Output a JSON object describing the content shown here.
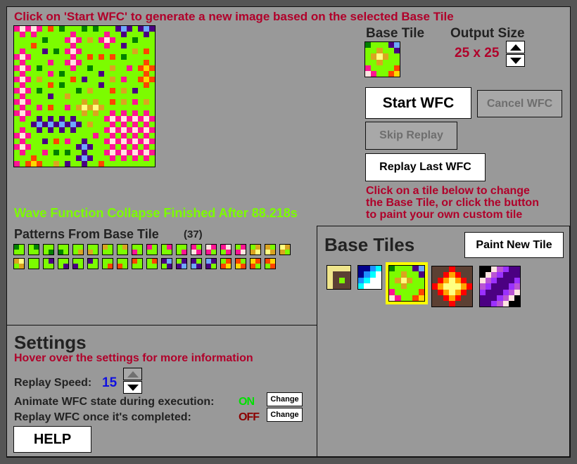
{
  "header": {
    "instruction": "Click on 'Start WFC' to generate a new image based on the selected Base Tile"
  },
  "palette": {
    "G": "#7CFC00",
    "P": "#FF1493",
    "W": "#FFE4E1",
    "O": "#FF4500",
    "D": "#008000",
    "U": "#4B0082",
    "B": "#6EA8FF",
    "A": "#DAA520",
    "Y": "#FFD700",
    "L": "#FFFF80",
    "K": "#000000",
    "N": "#00008B",
    "Z": "#1E90FF",
    "C": "#00FFFF",
    "X": "#FFFFFF",
    "E": "#F0E68C",
    "R": "#FF0000",
    "F": "#FFA500",
    "H": "#5C4033",
    "M": "#BA55D3",
    "V": "#9B30FF",
    "Q": "#FFFF80"
  },
  "output": {
    "size": 25,
    "rows": [
      "PWPWPGOGDGGGDGDGGGUBUGUBU",
      "GPGPGGGGGGPGGGGGPGGUGGGUG",
      "GGGGGDGGGPWPGAGPWPGGGDGGG",
      "GGGOGGGGGGPGGGGGPGGUGGGGG",
      "GPGGGUGDGPWPGGGGGGGGGAGOG",
      "PWPGGGGGGGPGGOGOGOGDGGGGG",
      "GPGGGGPGGPWPGGGGGGGGGGGOG",
      "PWPGDGGGGGPGGDGGGAGGPGOYO",
      "GPGGGGPGDGGGGGGUGGGGGGGOG",
      "PWPGAGGGGGOGUGGGGAGPGGOYO",
      "GPGGGGOGDGGGGGGUGGGGGGGOG",
      "PWPGDGGGGGGDGAGGGOGAGUGGG",
      "GPGGGGUGGAGGGGGGGGGGGGGGG",
      "PWPGGGGGGGGGAGAGGOGAGPGAG",
      "GPGGPGOGGPGALALAGGGGGGGGG",
      "PWPGGGGGGGGGAGAGGPGPGPGPG",
      "GPGGUGUGUGUGGGGGPWPWPWPWP",
      "GGGUBUBUBUBUGAGGGPGPGPGPG",
      "GPGGUGUGUGUGGGGGPWPWPWPWP",
      "PWPGGGGGGGGGGGPGGPGPGPGPG",
      "GPGGGUGOGPGGUGGGPWPWPWPWP",
      "PWPGGGGGGGGUBUGGGPGPGPGPG",
      "GPGGGPGDGDGGUGGGPWPWPWPWP",
      "GGGOGGGGGGGUBUGGGPGPGPGPG",
      "PGOYOGGAGUGGUGGOGGGGGGGGG"
    ]
  },
  "side": {
    "base_tile_label": "Base Tile",
    "output_size_label": "Output Size",
    "output_size_value": "25 x 25",
    "base_tile_rows": [
      "DGGGUB",
      "GGAGGU",
      "GALAGG",
      "GGAGGG",
      "PGGGGO",
      "WPGGOY"
    ],
    "start_label": "Start WFC",
    "cancel_label": "Cancel WFC",
    "skip_label": "Skip Replay",
    "replay_label": "Replay Last WFC",
    "hint": [
      "Click on a tile below to change",
      "the Base Tile, or click the button",
      "to paint your own custom tile"
    ]
  },
  "status": {
    "text": "Wave Function Collapse Finished After 88.218s",
    "color": "#7CFC00"
  },
  "patterns": {
    "title": "Patterns From Base Tile",
    "count": "(37)",
    "items": [
      "DGGG",
      "GDGG",
      "GGGD",
      "GGDG",
      "GGGA",
      "GGAG",
      "AGGG",
      "GAGG",
      "GGPG",
      "PGGG",
      "GPGG",
      "GGGP",
      "PGWP",
      "WPPG",
      "PWGP",
      "GPPW",
      "GAAL",
      "AGLA",
      "LAAG",
      "ALGA",
      "GGGG",
      "GUGG",
      "GGGU",
      "GGUG",
      "UGGG",
      "GGGO",
      "GGOG",
      "OGGG",
      "GOGG",
      "UBGU",
      "GUUB",
      "UGBU",
      "BUUG",
      "GOOY",
      "OGYO",
      "YOOG",
      "OYGO"
    ]
  },
  "base_tiles": {
    "title": "Base Tiles",
    "paint_label": "Paint New Tile",
    "selected_index": 2,
    "tiles": [
      {
        "name": "brown-square-tile",
        "rows": [
          "EEEE",
          "EHHH",
          "EHGH",
          "EHHH"
        ]
      },
      {
        "name": "blue-gradient-tile",
        "rows": [
          "NNZC",
          "NZCX",
          "ZCXX",
          "CXXX"
        ]
      },
      {
        "name": "green-flower-tile",
        "rows": [
          "DGGGUB",
          "GGAGGU",
          "GALAGG",
          "GGAGGG",
          "PGGGGO",
          "WPGGOY"
        ]
      },
      {
        "name": "fire-diamond-tile",
        "rows": [
          "HHHRHHH",
          "HHRFRHH",
          "HRFQFRH",
          "RFQQQFR",
          "HRFQFRH",
          "HHRFRHH",
          "HHHRHHH"
        ]
      },
      {
        "name": "purple-stripe-tile",
        "rows": [
          "KKWMVUU",
          "KWMVUUU",
          "WMVUUUV",
          "MVUUUVM",
          "VUUUVMW",
          "UUUVMWK",
          "UUVMWKK"
        ]
      }
    ]
  },
  "settings": {
    "title": "Settings",
    "hint": "Hover over the settings for more information",
    "replay_speed_label": "Replay Speed:",
    "replay_speed_value": "15",
    "animate_label": "Animate WFC state during execution:",
    "animate_value": "ON",
    "animate_color": "#00E000",
    "replay_label": "Replay WFC once it's completed:",
    "replay_value": "OFF",
    "replay_color": "#8B0000",
    "change_label": "Change",
    "help_label": "HELP"
  }
}
